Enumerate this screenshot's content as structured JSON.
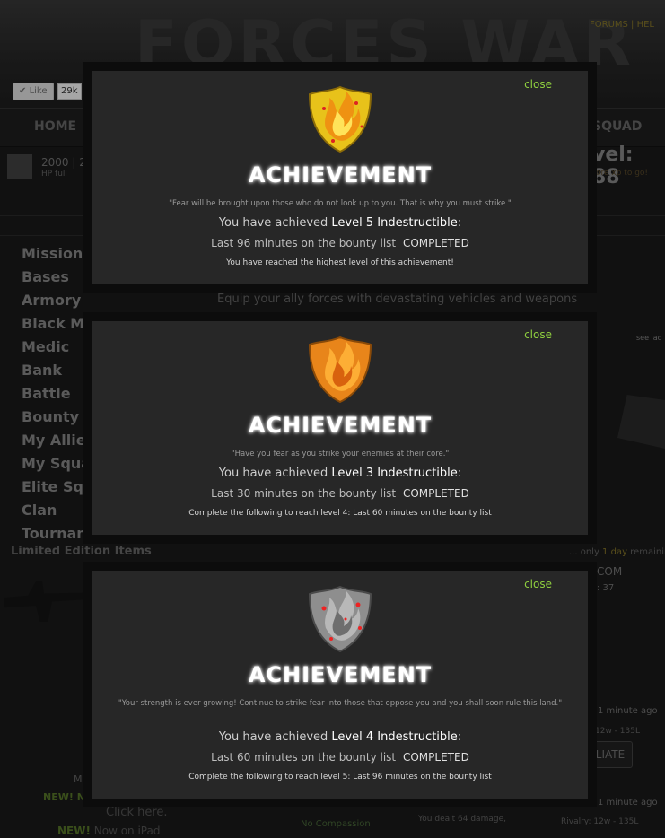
{
  "background": {
    "logo": "FORCES WAR",
    "top_links": "FORUMS  |  HEL",
    "like_label": "Like",
    "like_count": "29k",
    "nav_home": "HOME",
    "nav_squad": "SQUAD",
    "stats_text": "2000 | 2",
    "stats_sub": "HP full",
    "level_text": "vel: 88",
    "level_sub": "ore xp to go!",
    "sidebar_items": [
      "Missions",
      "Bases",
      "Armory",
      "Black Ma",
      "Medic",
      "Bank",
      "Battle",
      "Bounty",
      "My Allies",
      "My Squad",
      "Elite Squa",
      "Clan",
      "Tourname"
    ],
    "limited_edition": "Limited Edition Items",
    "equip_text": "Equip your ally forces with devastating vehicles and weapons",
    "see_ladder": "see lad",
    "only_prefix": "... only ",
    "only_days": "1 day",
    "only_suffix": " remaining",
    "com_text": "COM",
    "num_37": ": 37",
    "minute_ago_1": "1 minute ago",
    "rival_1": "12w - 135L",
    "retaliate_btn": "LIATE",
    "minute_ago_2": "1 minute ago",
    "rival_2": "Rivalry:  12w - 135L",
    "m_text": "M",
    "new_text_1": "NEW! N",
    "click_here": "Click here.",
    "new_label_2": "NEW!",
    "new_text_2": " Now on iPad",
    "no_compassion": "No Compassion",
    "dealt_text": "You dealt 64 damage,"
  },
  "dialogs": [
    {
      "close_label": "close",
      "title": "ACHIEVEMENT",
      "quote": "\"Fear will be brought upon those who do not look up to you. That is why you must strike \"",
      "achieved_prefix": "You have achieved ",
      "level_name": "Level 5 Indestructible",
      "achieved_suffix": ":",
      "task": "Last 96 minutes on the bounty list",
      "status": "COMPLETED",
      "note": "You have reached the highest level of this achievement!",
      "shield_icon": "gold-flame-shield-icon"
    },
    {
      "close_label": "close",
      "title": "ACHIEVEMENT",
      "quote": "\"Have you fear as you strike your enemies at their core.\"",
      "achieved_prefix": "You have achieved ",
      "level_name": "Level 3 Indestructible",
      "achieved_suffix": ":",
      "task": "Last 30 minutes on the bounty list",
      "status": "COMPLETED",
      "note": "Complete the following to reach level 4: Last 60 minutes on the bounty list",
      "shield_icon": "bronze-flame-shield-icon"
    },
    {
      "close_label": "close",
      "title": "ACHIEVEMENT",
      "quote": "\"Your strength is ever growing! Continue to strike fear into those that oppose you and you shall soon rule this land.\"",
      "achieved_prefix": "You have achieved ",
      "level_name": "Level 4 Indestructible",
      "achieved_suffix": ":",
      "task": "Last 60 minutes on the bounty list",
      "status": "COMPLETED",
      "note": "Complete the following to reach level 5: Last 96 minutes on the bounty list",
      "shield_icon": "silver-flame-shield-icon"
    }
  ],
  "colors": {
    "close_link": "#8fcf3f",
    "gold_shield": "#e8c21a",
    "bronze_shield": "#e8851a",
    "silver_shield": "#8e8e8e"
  }
}
